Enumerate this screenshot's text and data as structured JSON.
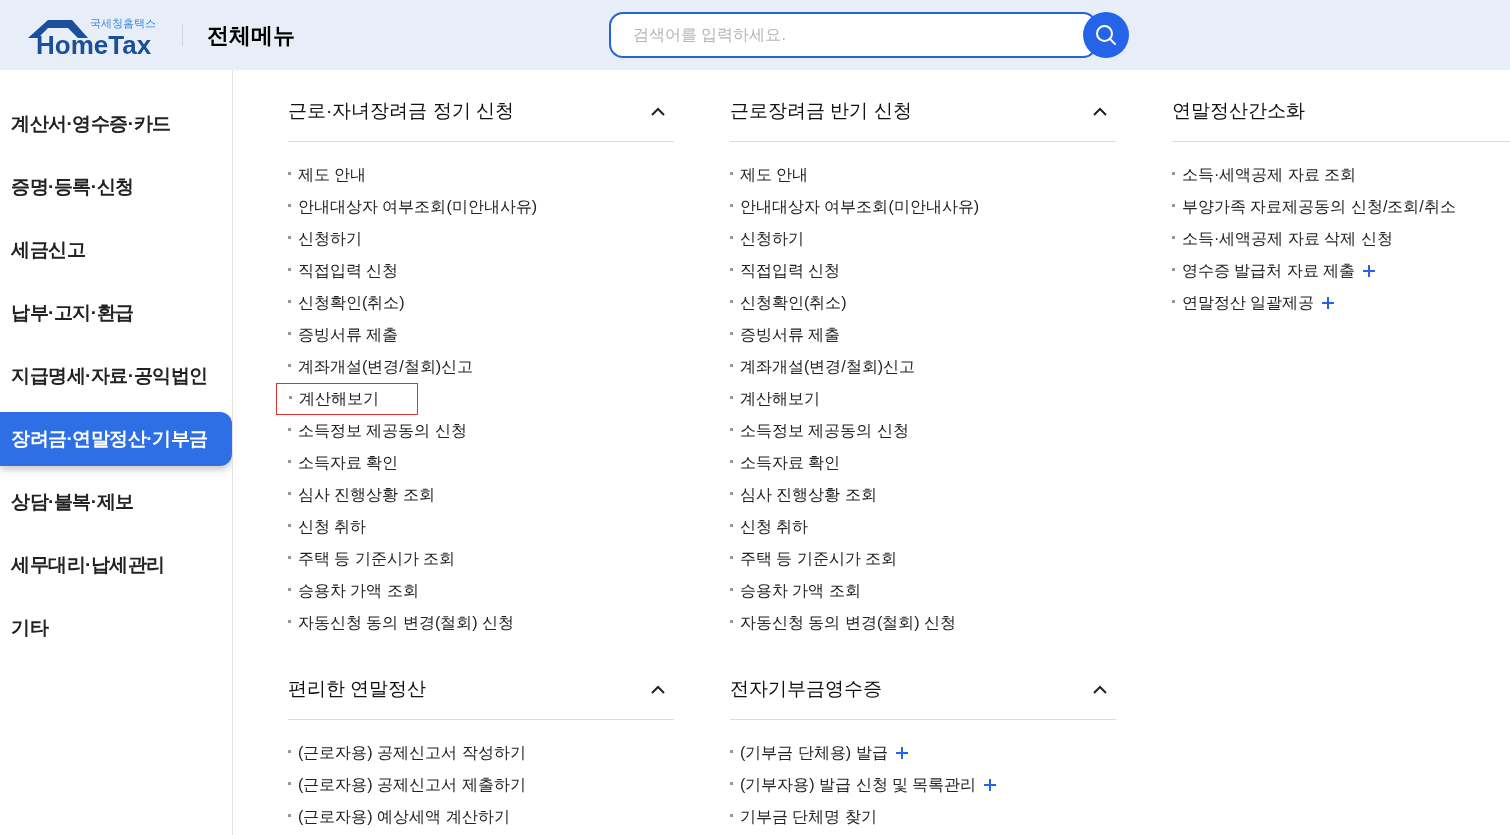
{
  "header": {
    "logo_subtitle": "국세청홈택스",
    "logo_title": "HomeTax",
    "page_title": "전체메뉴",
    "search": {
      "placeholder": "검색어를 입력하세요."
    }
  },
  "sidebar": {
    "items": [
      {
        "label": "계산서·영수증·카드",
        "selected": false
      },
      {
        "label": "증명·등록·신청",
        "selected": false
      },
      {
        "label": "세금신고",
        "selected": false
      },
      {
        "label": "납부·고지·환급",
        "selected": false
      },
      {
        "label": "지급명세·자료·공익법인",
        "selected": false
      },
      {
        "label": "장려금·연말정산·기부금",
        "selected": true
      },
      {
        "label": "상담·불복·제보",
        "selected": false
      },
      {
        "label": "세무대리·납세관리",
        "selected": false
      },
      {
        "label": "기타",
        "selected": false
      }
    ]
  },
  "sections": [
    {
      "title": "근로·자녀장려금 정기 신청",
      "expanded": true,
      "items": [
        {
          "label": "제도 안내",
          "plus": false,
          "highlighted": false
        },
        {
          "label": "안내대상자 여부조회(미안내사유)",
          "plus": false,
          "highlighted": false
        },
        {
          "label": "신청하기",
          "plus": false,
          "highlighted": false
        },
        {
          "label": "직접입력 신청",
          "plus": false,
          "highlighted": false
        },
        {
          "label": "신청확인(취소)",
          "plus": false,
          "highlighted": false
        },
        {
          "label": "증빙서류 제출",
          "plus": false,
          "highlighted": false
        },
        {
          "label": "계좌개설(변경/철회)신고",
          "plus": false,
          "highlighted": false
        },
        {
          "label": "계산해보기",
          "plus": false,
          "highlighted": true
        },
        {
          "label": "소득정보 제공동의 신청",
          "plus": false,
          "highlighted": false
        },
        {
          "label": "소득자료 확인",
          "plus": false,
          "highlighted": false
        },
        {
          "label": "심사 진행상황 조회",
          "plus": false,
          "highlighted": false
        },
        {
          "label": "신청 취하",
          "plus": false,
          "highlighted": false
        },
        {
          "label": "주택 등 기준시가 조회",
          "plus": false,
          "highlighted": false
        },
        {
          "label": "승용차 가액 조회",
          "plus": false,
          "highlighted": false
        },
        {
          "label": "자동신청 동의 변경(철회) 신청",
          "plus": false,
          "highlighted": false
        }
      ]
    },
    {
      "title": "근로장려금 반기 신청",
      "expanded": true,
      "items": [
        {
          "label": "제도 안내",
          "plus": false,
          "highlighted": false
        },
        {
          "label": "안내대상자 여부조회(미안내사유)",
          "plus": false,
          "highlighted": false
        },
        {
          "label": "신청하기",
          "plus": false,
          "highlighted": false
        },
        {
          "label": "직접입력 신청",
          "plus": false,
          "highlighted": false
        },
        {
          "label": "신청확인(취소)",
          "plus": false,
          "highlighted": false
        },
        {
          "label": "증빙서류 제출",
          "plus": false,
          "highlighted": false
        },
        {
          "label": "계좌개설(변경/철회)신고",
          "plus": false,
          "highlighted": false
        },
        {
          "label": "계산해보기",
          "plus": false,
          "highlighted": false
        },
        {
          "label": "소득정보 제공동의 신청",
          "plus": false,
          "highlighted": false
        },
        {
          "label": "소득자료 확인",
          "plus": false,
          "highlighted": false
        },
        {
          "label": "심사 진행상황 조회",
          "plus": false,
          "highlighted": false
        },
        {
          "label": "신청 취하",
          "plus": false,
          "highlighted": false
        },
        {
          "label": "주택 등 기준시가 조회",
          "plus": false,
          "highlighted": false
        },
        {
          "label": "승용차 가액 조회",
          "plus": false,
          "highlighted": false
        },
        {
          "label": "자동신청 동의 변경(철회) 신청",
          "plus": false,
          "highlighted": false
        }
      ]
    },
    {
      "title": "연말정산간소화",
      "items": [
        {
          "label": "소득·세액공제 자료 조회",
          "plus": false,
          "highlighted": false
        },
        {
          "label": "부양가족 자료제공동의 신청/조회/취소",
          "plus": false,
          "highlighted": false
        },
        {
          "label": "소득·세액공제 자료 삭제 신청",
          "plus": false,
          "highlighted": false
        },
        {
          "label": "영수증 발급처 자료 제출",
          "plus": true,
          "highlighted": false
        },
        {
          "label": "연말정산 일괄제공",
          "plus": true,
          "highlighted": false
        }
      ]
    },
    {
      "title": "편리한 연말정산",
      "expanded": true,
      "items": [
        {
          "label": "(근로자용) 공제신고서 작성하기",
          "plus": false,
          "highlighted": false
        },
        {
          "label": "(근로자용) 공제신고서 제출하기",
          "plus": false,
          "highlighted": false
        },
        {
          "label": "(근로자용) 예상세액 계산하기",
          "plus": false,
          "highlighted": false
        }
      ]
    },
    {
      "title": "전자기부금영수증",
      "expanded": true,
      "items": [
        {
          "label": "(기부금 단체용) 발급",
          "plus": true,
          "highlighted": false
        },
        {
          "label": "(기부자용) 발급 신청 및 목록관리",
          "plus": true,
          "highlighted": false
        },
        {
          "label": "기부금 단체명 찾기",
          "plus": false,
          "highlighted": false
        }
      ]
    }
  ]
}
